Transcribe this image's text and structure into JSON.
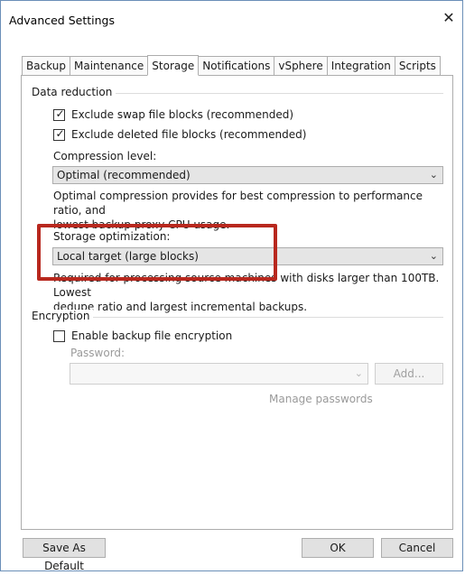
{
  "window": {
    "title": "Advanced Settings",
    "close_glyph": "✕"
  },
  "tabs": [
    {
      "label": "Backup"
    },
    {
      "label": "Maintenance"
    },
    {
      "label": "Storage",
      "active": true
    },
    {
      "label": "Notifications"
    },
    {
      "label": "vSphere"
    },
    {
      "label": "Integration"
    },
    {
      "label": "Scripts"
    }
  ],
  "data_reduction": {
    "group_label": "Data reduction",
    "exclude_swap": {
      "label": "Exclude swap file blocks (recommended)",
      "checked": true
    },
    "exclude_deleted": {
      "label": "Exclude deleted file blocks (recommended)",
      "checked": true
    },
    "compression_label": "Compression level:",
    "compression_value": "Optimal (recommended)",
    "compression_desc_1": "Optimal compression provides for best compression to performance ratio, and",
    "compression_desc_2": "lowest backup proxy CPU usage.",
    "storage_opt_label": "Storage optimization:",
    "storage_opt_value": "Local target (large blocks)",
    "storage_opt_desc_1": "Required for processing source machines with disks larger than 100TB. Lowest",
    "storage_opt_desc_2": "dedupe ratio and largest incremental backups."
  },
  "encryption": {
    "group_label": "Encryption",
    "enable": {
      "label": "Enable backup file encryption",
      "checked": false
    },
    "password_label": "Password:",
    "add_button": "Add...",
    "manage_link": "Manage passwords"
  },
  "footer": {
    "save_default": "Save As Default",
    "ok": "OK",
    "cancel": "Cancel"
  },
  "glyphs": {
    "check": "✓",
    "chevron": "⌄"
  },
  "colors": {
    "highlight": "#b8281e",
    "window_border": "#6b8fb8"
  }
}
